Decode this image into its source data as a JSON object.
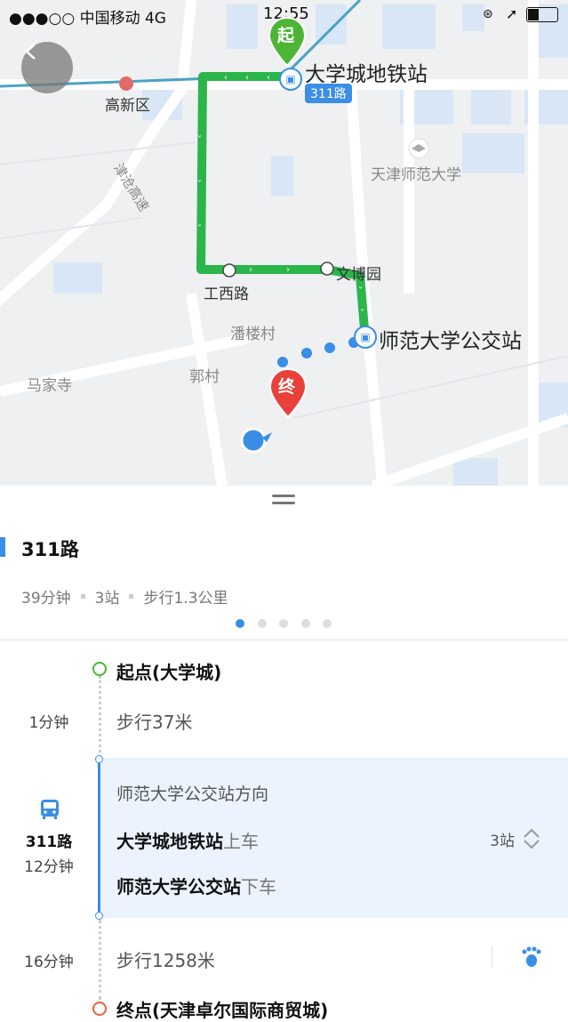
{
  "status_bar": {
    "carrier": "●●●○○ 中国移动   4G",
    "time": "12:55"
  },
  "map": {
    "labels": {
      "start_station": "大学城地铁站",
      "route_tag": "311路",
      "end_station": "师范大学公交站",
      "gaoxin": "高新区",
      "tianjin_normal": "天津师范大学",
      "gongxi": "工西路",
      "wenbo": "文博园",
      "panlou": "潘楼村",
      "guocun": "郭村",
      "majiasi": "马家寺",
      "highway": "津沧高速"
    },
    "start_pin": "起",
    "end_pin": "终",
    "colors": {
      "route_green": "#2bb54a",
      "walk_blue": "#3a8ee6",
      "start_green": "#4cb535",
      "end_red": "#e8403a"
    }
  },
  "sheet": {
    "route_name": "311路",
    "summary": {
      "duration": "39分钟",
      "stops": "3站",
      "walk": "步行1.3公里"
    },
    "page_dots": 5,
    "active_dot": 1,
    "steps": {
      "start_label": "起点(大学城)",
      "walk1_time": "1分钟",
      "walk1_text": "步行37米",
      "bus_direction": "师范大学公交站方向",
      "bus_route": "311路",
      "bus_time": "12分钟",
      "board_station": "大学城地铁站",
      "board_action": "上车",
      "alight_station": "师范大学公交站",
      "alight_action": "下车",
      "stop_count": "3站",
      "walk2_time": "16分钟",
      "walk2_text": "步行1258米",
      "end_label": "终点(天津卓尔国际商贸城)"
    }
  }
}
